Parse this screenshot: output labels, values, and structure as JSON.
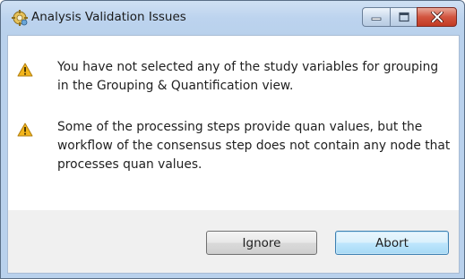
{
  "window": {
    "title": "Analysis Validation Issues",
    "icon": "app-gear-icon"
  },
  "caption_buttons": [
    {
      "name": "minimize",
      "icon": "minimize-icon"
    },
    {
      "name": "maximize",
      "icon": "maximize-icon"
    },
    {
      "name": "close",
      "icon": "close-icon"
    }
  ],
  "messages": [
    {
      "icon": "warning-icon",
      "text": "You have not selected any of the study variables for grouping in the Grouping & Quantification view."
    },
    {
      "icon": "warning-icon",
      "text": "Some of the processing steps provide quan values, but the workflow of the consensus step does not contain any node that processes quan values."
    }
  ],
  "buttons": {
    "ignore_label": "Ignore",
    "abort_label": "Abort"
  },
  "colors": {
    "titlebar": "#bcd3ee",
    "close_button": "#c9452f",
    "warning": "#f2b51c",
    "default_button_border": "#3c7fb1"
  }
}
